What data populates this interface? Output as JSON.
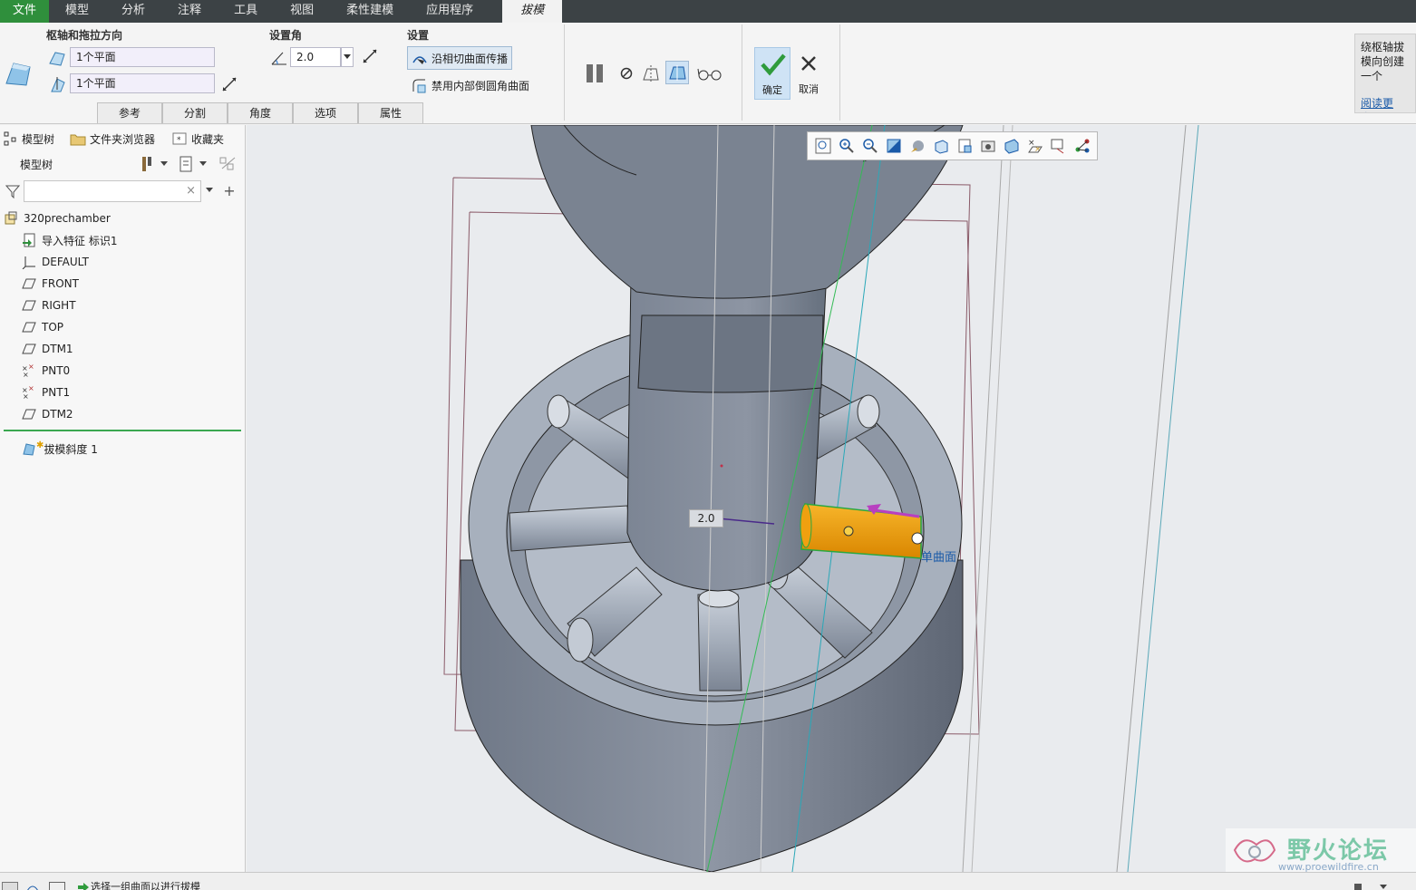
{
  "menu": {
    "items": [
      "文件",
      "模型",
      "分析",
      "注释",
      "工具",
      "视图",
      "柔性建模",
      "应用程序"
    ],
    "active_tab": "拔模"
  },
  "ribbon": {
    "pivot_group_label": "枢轴和拖拉方向",
    "pivot_field": "1个平面",
    "drag_field": "1个平面",
    "angle_group_label": "设置角",
    "angle_value": "2.0",
    "settings_group_label": "设置",
    "tangent_button": "沿相切曲面传播",
    "disable_round_label": "禁用内部倒圆角曲面",
    "subtabs": [
      "参考",
      "分割",
      "角度",
      "选项",
      "属性"
    ],
    "ok_label": "确定",
    "cancel_label": "取消",
    "help_text": "绕枢轴拔模向创建一个",
    "help_link": "阅读更多..."
  },
  "left_panel": {
    "tabs": [
      "模型树",
      "文件夹浏览器",
      "收藏夹"
    ],
    "tree_header": "模型树",
    "filter_placeholder": "",
    "tree_items": [
      {
        "label": "320prechamber",
        "icon": "part-icon"
      },
      {
        "label": "导入特征 标识1",
        "icon": "import-feature-icon"
      },
      {
        "label": "DEFAULT",
        "icon": "csys-icon"
      },
      {
        "label": "FRONT",
        "icon": "datum-plane-icon"
      },
      {
        "label": "RIGHT",
        "icon": "datum-plane-icon"
      },
      {
        "label": "TOP",
        "icon": "datum-plane-icon"
      },
      {
        "label": "DTM1",
        "icon": "datum-plane-icon"
      },
      {
        "label": "PNT0",
        "icon": "datum-point-icon"
      },
      {
        "label": "PNT1",
        "icon": "datum-point-icon"
      },
      {
        "label": "DTM2",
        "icon": "datum-plane-icon"
      }
    ],
    "active_feature": "拔模斜度 1"
  },
  "viewport": {
    "angle_tag": "2.0",
    "surface_label": "单曲面",
    "watermark": "野火论坛",
    "watermark_url": "www.proewildfire.cn"
  },
  "status": {
    "message": "选择一组曲面以进行拔模"
  },
  "colors": {
    "menubar": "#3c4245",
    "file_tab": "#2f8f3c",
    "model_shade": "#8a92a0",
    "highlight": "#f2a000"
  }
}
